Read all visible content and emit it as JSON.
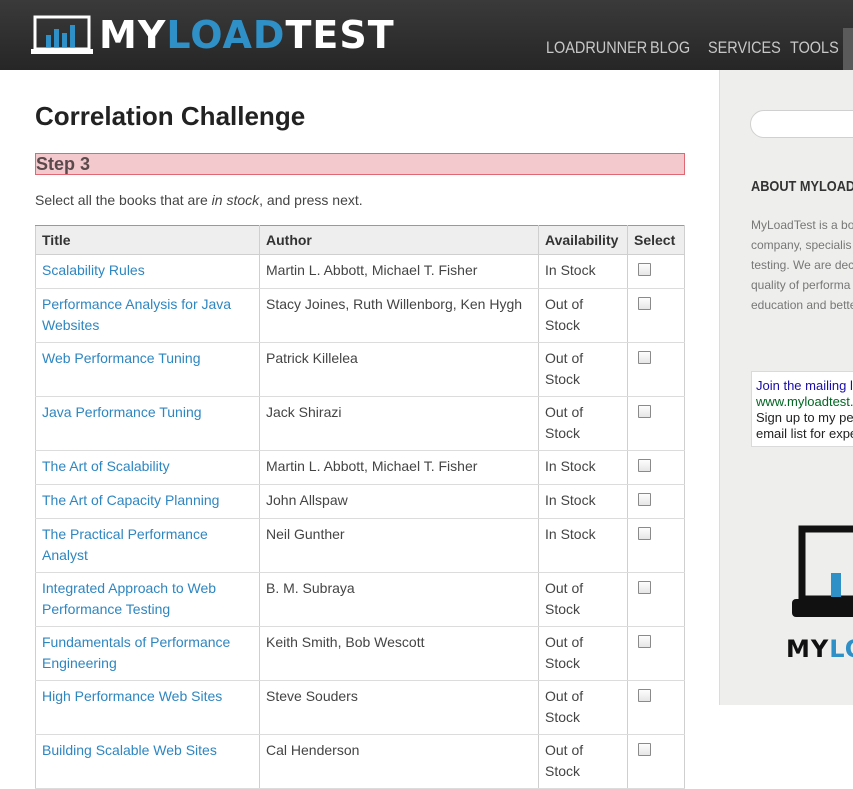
{
  "header": {
    "logo_prefix": "MY",
    "logo_accent": "LOAD",
    "logo_suffix": "TEST",
    "nav": [
      "LOADRUNNER",
      "BLOG",
      "SERVICES",
      "TOOLS"
    ]
  },
  "main": {
    "title": "Correlation Challenge",
    "step": "Step 3",
    "instruction_prefix": "Select all the books that are ",
    "instruction_em": "in stock",
    "instruction_suffix": ", and press next.",
    "table": {
      "headers": [
        "Title",
        "Author",
        "Availability",
        "Select"
      ],
      "rows": [
        {
          "title": "Scalability Rules",
          "author": "Martin L. Abbott, Michael T. Fisher",
          "availability": "In Stock"
        },
        {
          "title": "Performance Analysis for Java Websites",
          "author": "Stacy Joines, Ruth Willenborg, Ken Hygh",
          "availability": "Out of Stock"
        },
        {
          "title": "Web Performance Tuning",
          "author": "Patrick Killelea",
          "availability": "Out of Stock"
        },
        {
          "title": "Java Performance Tuning",
          "author": "Jack Shirazi",
          "availability": "Out of Stock"
        },
        {
          "title": "The Art of Scalability",
          "author": "Martin L. Abbott, Michael T. Fisher",
          "availability": "In Stock"
        },
        {
          "title": "The Art of Capacity Planning",
          "author": "John Allspaw",
          "availability": "In Stock"
        },
        {
          "title": "The Practical Performance Analyst",
          "author": "Neil Gunther",
          "availability": "In Stock"
        },
        {
          "title": "Integrated Approach to Web Performance Testing",
          "author": "B. M. Subraya",
          "availability": "Out of Stock"
        },
        {
          "title": "Fundamentals of Performance Engineering",
          "author": "Keith Smith, Bob Wescott",
          "availability": "Out of Stock"
        },
        {
          "title": "High Performance Web Sites",
          "author": "Steve Souders",
          "availability": "Out of Stock"
        },
        {
          "title": "Building Scalable Web Sites",
          "author": "Cal Henderson",
          "availability": "Out of Stock"
        }
      ]
    }
  },
  "sidebar": {
    "about_title": "ABOUT MYLOADTI",
    "about_lines": [
      "MyLoadTest is a bo",
      "company, specialis",
      "testing. We are dec",
      "quality of performa",
      "education and bette"
    ],
    "mailing": {
      "line1": "Join the mailing l",
      "line2": "www.myloadtest.",
      "line3": "Sign up to my pe",
      "line4": "email list for expe"
    },
    "logo_prefix": "MY",
    "logo_accent": "LO"
  }
}
